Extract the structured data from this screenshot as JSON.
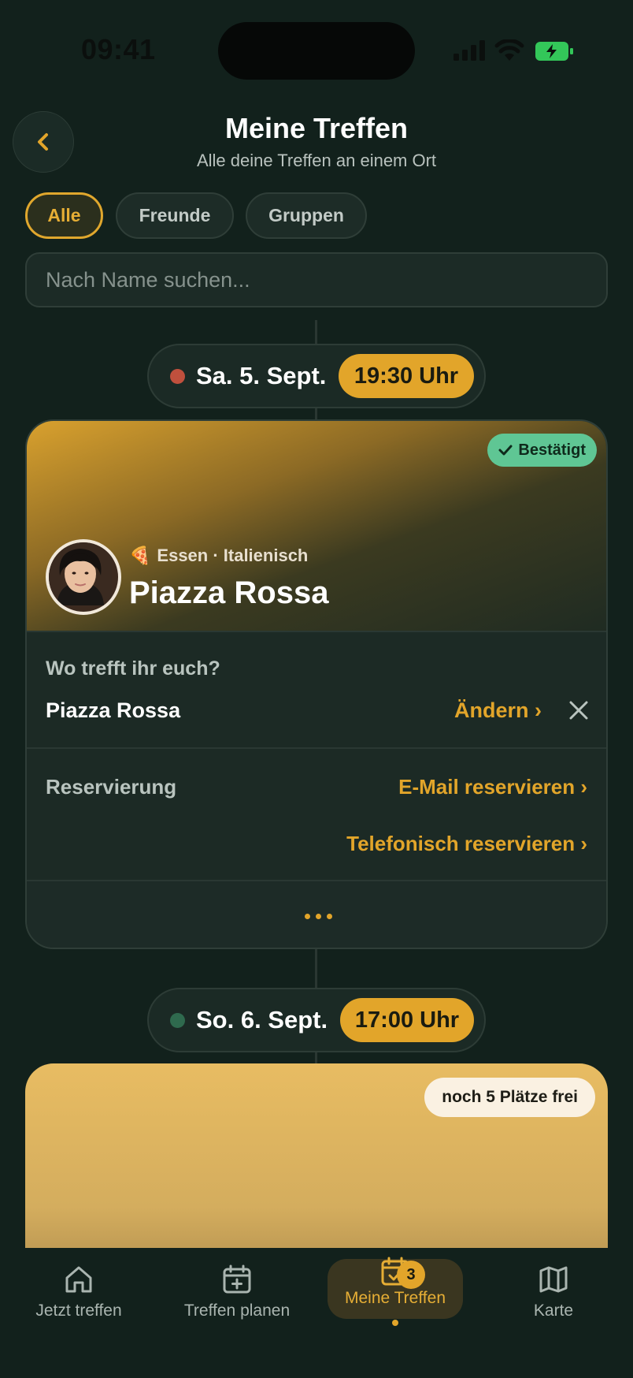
{
  "status_bar": {
    "time": "09:41"
  },
  "header": {
    "title": "Meine Treffen",
    "subtitle": "Alle deine Treffen an einem Ort"
  },
  "filters": [
    {
      "label": "Alle",
      "active": true
    },
    {
      "label": "Freunde",
      "active": false
    },
    {
      "label": "Gruppen",
      "active": false
    }
  ],
  "search": {
    "placeholder": "Nach Name suchen..."
  },
  "meetings": [
    {
      "date": "Sa. 5. Sept.",
      "time": "19:30 Uhr",
      "dot_color": "#c0503d",
      "status": "Bestätigt",
      "category_emoji": "🍕",
      "category": "Essen · Italienisch",
      "venue": "Piazza Rossa",
      "location_question": "Wo trefft ihr euch?",
      "location": "Piazza Rossa",
      "change_label": "Ändern ›",
      "reservation_label": "Reservierung",
      "email_reserve": "E-Mail reservieren ›",
      "phone_reserve": "Telefonisch reservieren ›"
    },
    {
      "date": "So. 6. Sept.",
      "time": "17:00 Uhr",
      "dot_color": "#2f6a4e",
      "spots": "noch 5 Plätze frei"
    }
  ],
  "bottom_nav": [
    {
      "label": "Jetzt treffen",
      "icon": "home-icon"
    },
    {
      "label": "Treffen planen",
      "icon": "calendar-plus-icon"
    },
    {
      "label": "Meine Treffen",
      "icon": "calendar-check-icon",
      "active": true,
      "badge": "3"
    },
    {
      "label": "Karte",
      "icon": "map-icon"
    }
  ],
  "colors": {
    "accent": "#e2a52a",
    "background": "#12211c",
    "confirmed": "#5fc694"
  }
}
